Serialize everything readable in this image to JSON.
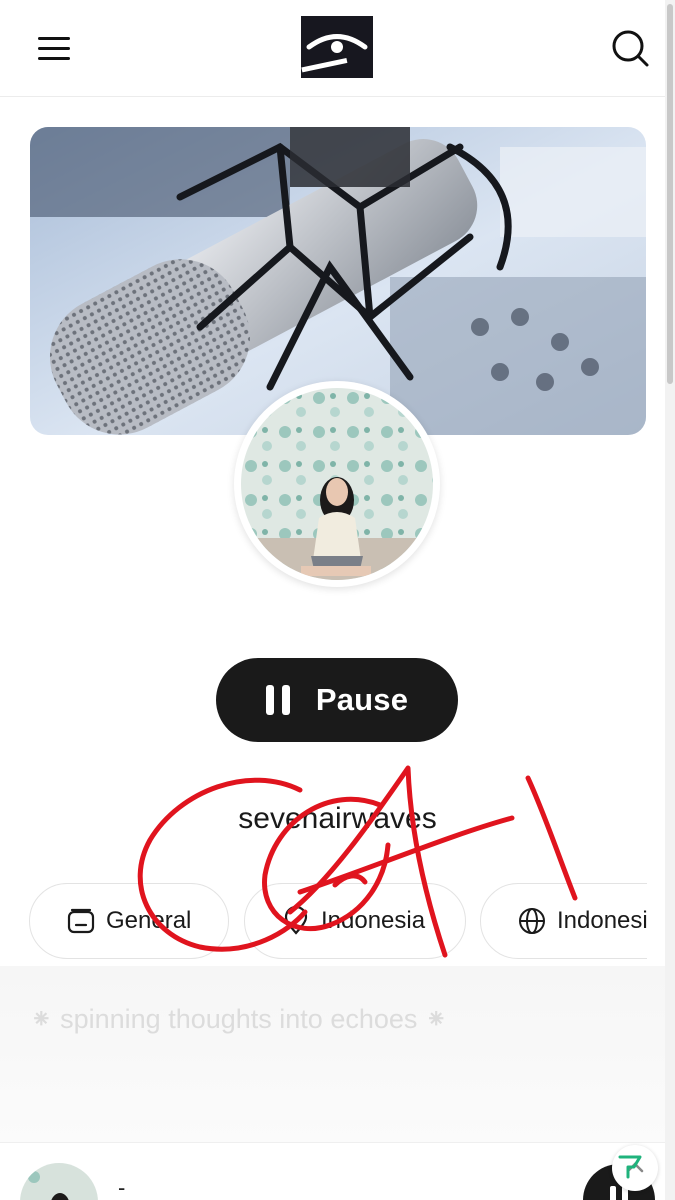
{
  "header": {
    "menu_icon": "hamburger-menu-icon",
    "logo": "app-logo",
    "search_icon": "search-icon"
  },
  "banner": {
    "image": "microphone-studio-photo"
  },
  "avatar": {
    "image": "station-profile-photo"
  },
  "player": {
    "pause_label": "Pause",
    "pause_icon": "pause-icon"
  },
  "station": {
    "name": "sevenairwaves"
  },
  "chips": [
    {
      "label": "General",
      "icon": "radio-icon"
    },
    {
      "label": "Indonesia",
      "icon": "location-pin-icon"
    },
    {
      "label": "Indonesian",
      "icon": "globe-icon"
    }
  ],
  "tagline": "⁕ spinning thoughts into echoes ⁕",
  "mini_player": {
    "title": "-",
    "play_icon": "pause-icon"
  },
  "overlay": {
    "annotation": "red-handwritten-scribble",
    "color": "#e0141e"
  },
  "colors": {
    "accent": "#1a1a1a",
    "background": "#ffffff"
  }
}
